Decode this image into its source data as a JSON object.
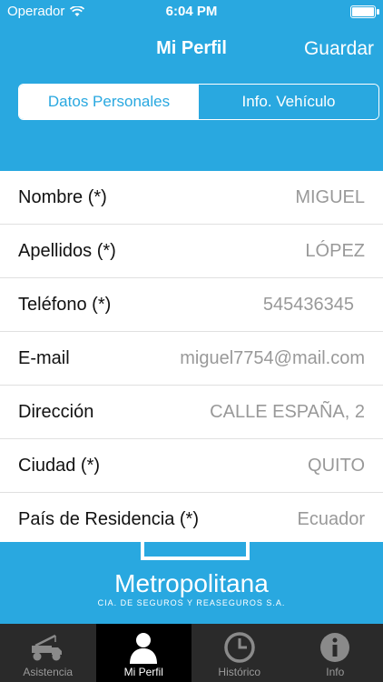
{
  "status": {
    "carrier": "Operador",
    "time": "6:04 PM"
  },
  "nav": {
    "title": "Mi Perfil",
    "save_label": "Guardar"
  },
  "segments": {
    "personal": "Datos Personales",
    "vehicle": "Info. Vehículo"
  },
  "form": {
    "rows": [
      {
        "label": "Nombre (*)",
        "value": "MIGUEL"
      },
      {
        "label": "Apellidos (*)",
        "value": "LÓPEZ"
      },
      {
        "label": "Teléfono (*)",
        "value": "545436345"
      },
      {
        "label": "E-mail",
        "value": "miguel7754@mail.com"
      },
      {
        "label": "Dirección",
        "value": "CALLE ESPAÑA, 2"
      },
      {
        "label": "Ciudad (*)",
        "value": "QUITO"
      },
      {
        "label": "País de Residencia (*)",
        "value": "Ecuador"
      }
    ]
  },
  "brand": {
    "name": "Metropolitana",
    "tagline": "CIA. DE SEGUROS Y REASEGUROS S.A."
  },
  "tabs": [
    {
      "label": "Asistencia",
      "icon": "tow-truck-icon"
    },
    {
      "label": "Mi Perfil",
      "icon": "person-icon"
    },
    {
      "label": "Histórico",
      "icon": "clock-icon"
    },
    {
      "label": "Info",
      "icon": "info-icon"
    }
  ],
  "colors": {
    "accent": "#29a8e0",
    "tabbar": "#2a2a2a"
  }
}
